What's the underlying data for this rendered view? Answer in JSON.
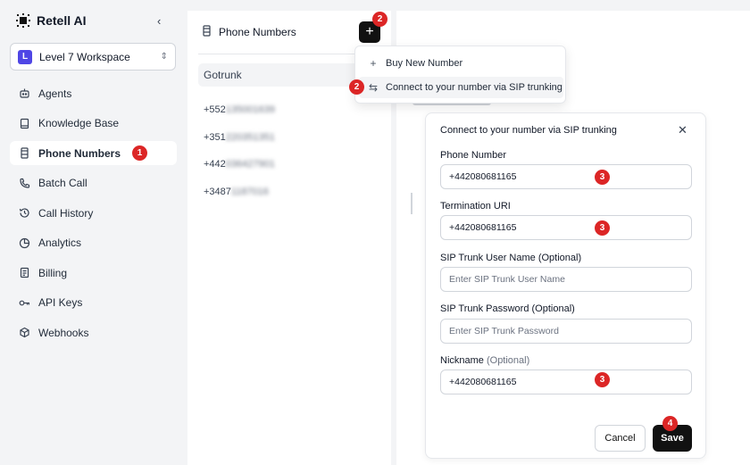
{
  "brand": {
    "name": "Retell AI",
    "collapse_icon": "chevron-left-icon"
  },
  "workspace": {
    "badge": "L",
    "name": "Level 7 Workspace",
    "icon": "chevron-up-down-icon"
  },
  "sidebar": {
    "items": [
      {
        "label": "Agents",
        "icon": "robot-icon"
      },
      {
        "label": "Knowledge Base",
        "icon": "book-icon"
      },
      {
        "label": "Phone Numbers",
        "icon": "phone-device-icon",
        "active": true
      },
      {
        "label": "Batch Call",
        "icon": "phone-icon"
      },
      {
        "label": "Call History",
        "icon": "history-icon"
      },
      {
        "label": "Analytics",
        "icon": "pie-chart-icon"
      },
      {
        "label": "Billing",
        "icon": "receipt-icon"
      },
      {
        "label": "API Keys",
        "icon": "key-icon"
      },
      {
        "label": "Webhooks",
        "icon": "webhook-icon"
      }
    ]
  },
  "phone_panel": {
    "title": "Phone Numbers",
    "add_label": "+",
    "trunk_label": "Gotrunk",
    "numbers": [
      {
        "prefix": "+552",
        "rest": "135001639"
      },
      {
        "prefix": "+351",
        "rest": "220351351"
      },
      {
        "prefix": "+442",
        "rest": "036427901"
      },
      {
        "prefix": "+3487",
        "rest": "1187016"
      }
    ]
  },
  "dropdown": {
    "items": [
      {
        "label": "Buy New Number",
        "icon": "plus-icon"
      },
      {
        "label": "Connect to your number via SIP trunking",
        "icon": "arrows-exchange-icon"
      }
    ]
  },
  "modal": {
    "title": "Connect to your number via SIP trunking",
    "close_icon": "close-icon",
    "phone_number": {
      "label": "Phone Number",
      "value": "+442080681165"
    },
    "termination_uri": {
      "label": "Termination URI",
      "value": "+442080681165"
    },
    "sip_user": {
      "label": "SIP Trunk User Name (Optional)",
      "placeholder": "Enter SIP Trunk User Name"
    },
    "sip_password": {
      "label": "SIP Trunk Password (Optional)",
      "placeholder": "Enter SIP Trunk Password"
    },
    "nickname": {
      "label": "Nickname",
      "optional": "(Optional)",
      "value": "+442080681165"
    },
    "cancel_label": "Cancel",
    "save_label": "Save"
  },
  "markers": {
    "m1": "1",
    "m2a": "2",
    "m2b": "2",
    "m3a": "3",
    "m3b": "3",
    "m3c": "3",
    "m4": "4"
  },
  "colors": {
    "marker": "#dc2626",
    "primary_button": "#111111",
    "workspace_badge": "#4f46e5"
  }
}
